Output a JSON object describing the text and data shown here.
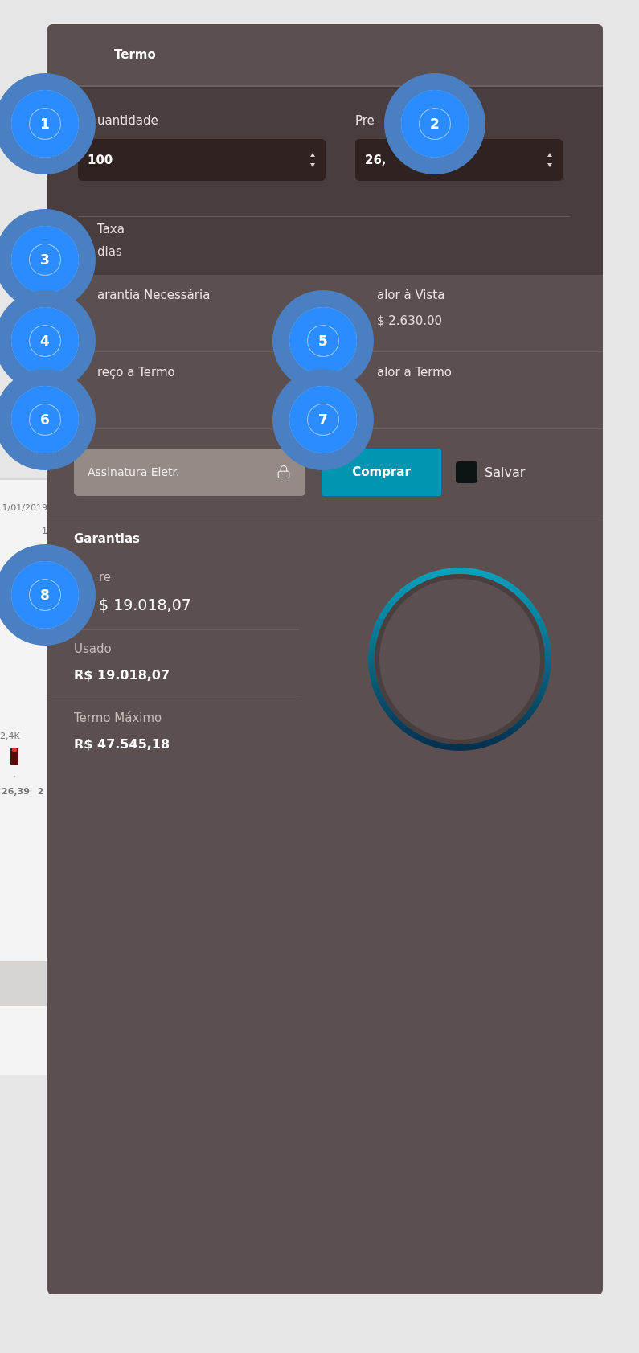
{
  "background_app": {
    "date": "1/01/2019",
    "axis_label": "1",
    "volume": "2,4K",
    "prices": [
      "26,39",
      "2"
    ]
  },
  "panel": {
    "title": "Termo",
    "inputs": [
      {
        "label": "uantidade",
        "value": "100"
      },
      {
        "label": "Pre",
        "value": "26,"
      }
    ],
    "rate": {
      "label": "Taxa",
      "value": "dias"
    },
    "summary": [
      {
        "label": "arantia Necessária"
      },
      {
        "label": "alor à Vista",
        "value": "$ 2.630.00"
      },
      {
        "label": "reço a Termo"
      },
      {
        "label": "alor a Termo"
      }
    ],
    "signature": {
      "placeholder": "Assinatura Eletr."
    },
    "buy_button": "Comprar",
    "save": {
      "label": "Salvar",
      "checked": false
    },
    "guarantees": {
      "title": "Garantias",
      "items": [
        {
          "label": "re",
          "value": "$ 19.018,07"
        },
        {
          "label": "Usado",
          "value": "R$ 19.018,07"
        },
        {
          "label": "Termo Máximo",
          "value": "R$ 47.545,18"
        }
      ]
    }
  },
  "markers": [
    "1",
    "2",
    "3",
    "4",
    "5",
    "6",
    "7",
    "8"
  ]
}
